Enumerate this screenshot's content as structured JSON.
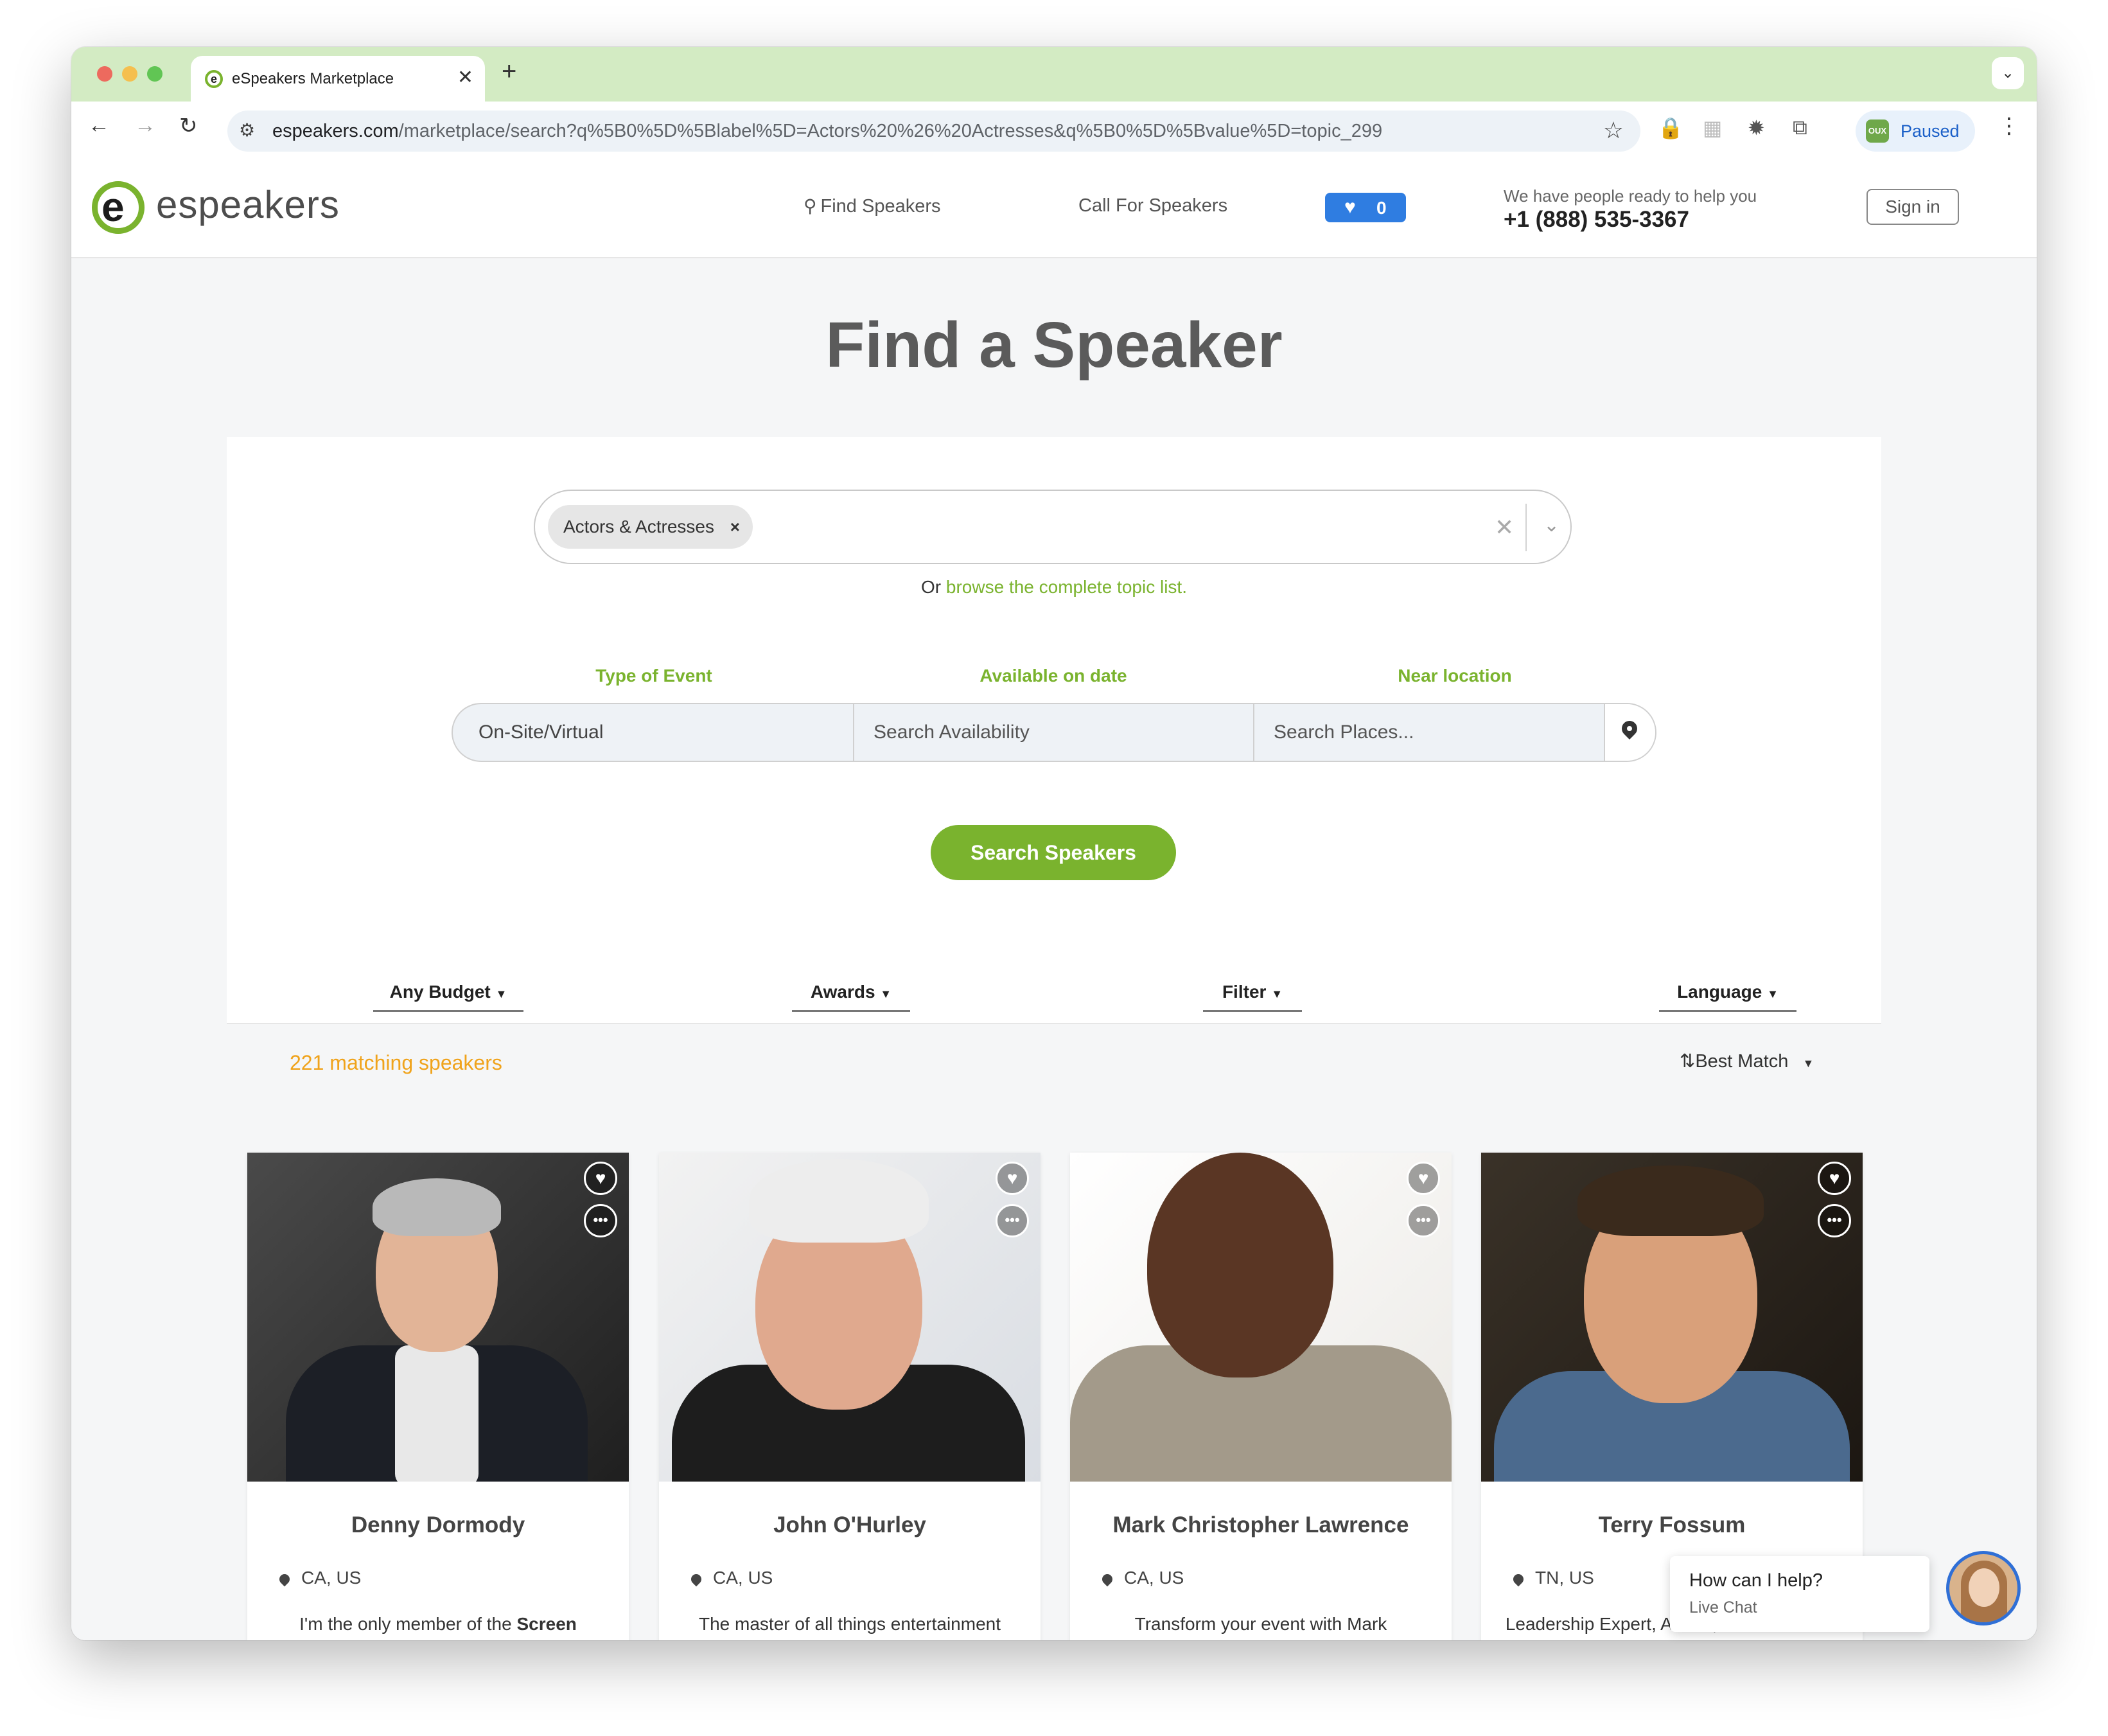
{
  "browser": {
    "tab_title": "eSpeakers Marketplace",
    "tab_close": "✕",
    "new_tab": "+",
    "url_host": "espeakers.com",
    "url_path": "/marketplace/search?q%5B0%5D%5Blabel%5D=Actors%20%26%20Actresses&q%5B0%5D%5Bvalue%5D=topic_299",
    "profile_status": "Paused",
    "profile_badge": "OUX"
  },
  "header": {
    "logo_text": "espeakers",
    "logo_mark": "e",
    "nav": {
      "find_speakers": "Find Speakers",
      "call_for_speakers": "Call For Speakers"
    },
    "favorites_count": "0",
    "help_text": "We have people ready to help you",
    "phone": "+1 (888) 535-3367",
    "sign_in": "Sign in"
  },
  "main": {
    "title": "Find a Speaker",
    "topic_chip": "Actors & Actresses",
    "topic_chip_remove": "×",
    "browse_prefix": "Or ",
    "browse_link": "browse the complete topic list.",
    "labels": {
      "event_type": "Type of Event",
      "available_date": "Available on date",
      "near_location": "Near location"
    },
    "event_type_value": "On-Site/Virtual",
    "availability_placeholder": "Search Availability",
    "places_placeholder": "Search Places...",
    "search_button": "Search Speakers",
    "filters": {
      "budget": "Any Budget",
      "awards": "Awards",
      "filter": "Filter",
      "language": "Language"
    },
    "results_count": "221 matching speakers",
    "sort_label": "Best Match"
  },
  "speakers": [
    {
      "name": "Denny Dormody",
      "location": "CA, US",
      "desc_prefix": "I'm the only member of the ",
      "desc_bold": "Screen"
    },
    {
      "name": "John O'Hurley",
      "location": "CA, US",
      "desc_prefix": "The master of all things entertainment",
      "desc_bold": ""
    },
    {
      "name": "Mark Christopher Lawrence",
      "location": "CA, US",
      "desc_prefix": "Transform your event with Mark",
      "desc_bold": ""
    },
    {
      "name": "Terry Fossum",
      "location": "TN, US",
      "desc_prefix": "Leadership Expert, Author, & Professional",
      "desc_bold": ""
    }
  ],
  "chat": {
    "prompt": "How can I help?",
    "subtitle": "Live Chat"
  },
  "colors": {
    "brand_green": "#7ab32e",
    "count_orange": "#f0a31b",
    "favorites_blue": "#2f7de1"
  }
}
